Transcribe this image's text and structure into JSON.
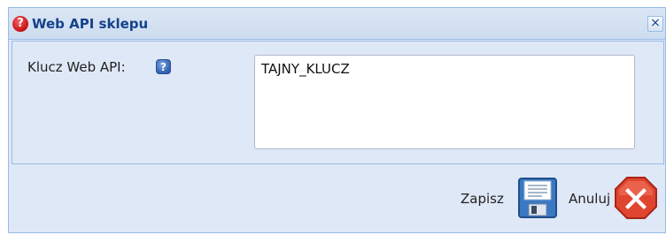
{
  "dialog": {
    "title": "Web API sklepu",
    "title_icon": "question-icon",
    "close_icon": "close-icon"
  },
  "form": {
    "label": "Klucz Web API:",
    "help_icon": "help-icon",
    "value": "TAJNY_KLUCZ"
  },
  "footer": {
    "save_label": "Zapisz",
    "save_icon": "floppy-disk-icon",
    "cancel_label": "Anuluj",
    "cancel_icon": "red-x-icon"
  },
  "colors": {
    "title_text": "#15428b",
    "panel_bg": "#dfe8f6",
    "border": "#99bbe8",
    "cancel_red": "#d9382b"
  }
}
